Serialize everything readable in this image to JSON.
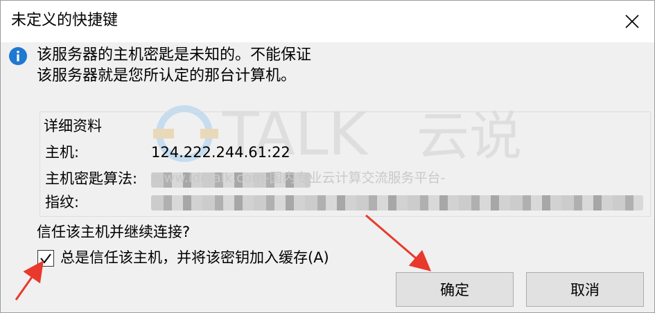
{
  "window": {
    "title": "未定义的快捷键"
  },
  "message": {
    "text": "该服务器的主机密匙是未知的。不能保证该服务器就是您所认定的那台计算机。"
  },
  "details": {
    "title": "详细资料",
    "rows": [
      {
        "label": "主机:",
        "value": "124.222.244.61:22"
      },
      {
        "label": "主机密匙算法:",
        "value": ""
      },
      {
        "label": "指纹:",
        "value": ""
      }
    ]
  },
  "trust": {
    "question": "信任该主机并继续连接?",
    "checkbox_label": "总是信任该主机，并将该密钥加入缓存(A)",
    "checkbox_checked": true
  },
  "buttons": {
    "ok_label": "确定",
    "cancel_label": "取消"
  },
  "watermark": {
    "text": "www.idctalk.com-国内专业云计算交流服务平台-"
  },
  "colors": {
    "info_icon": "#1f78d1",
    "arrow": "#e8392c"
  },
  "icons": {
    "info": "info-icon",
    "close": "close-icon",
    "check": "check-icon"
  }
}
